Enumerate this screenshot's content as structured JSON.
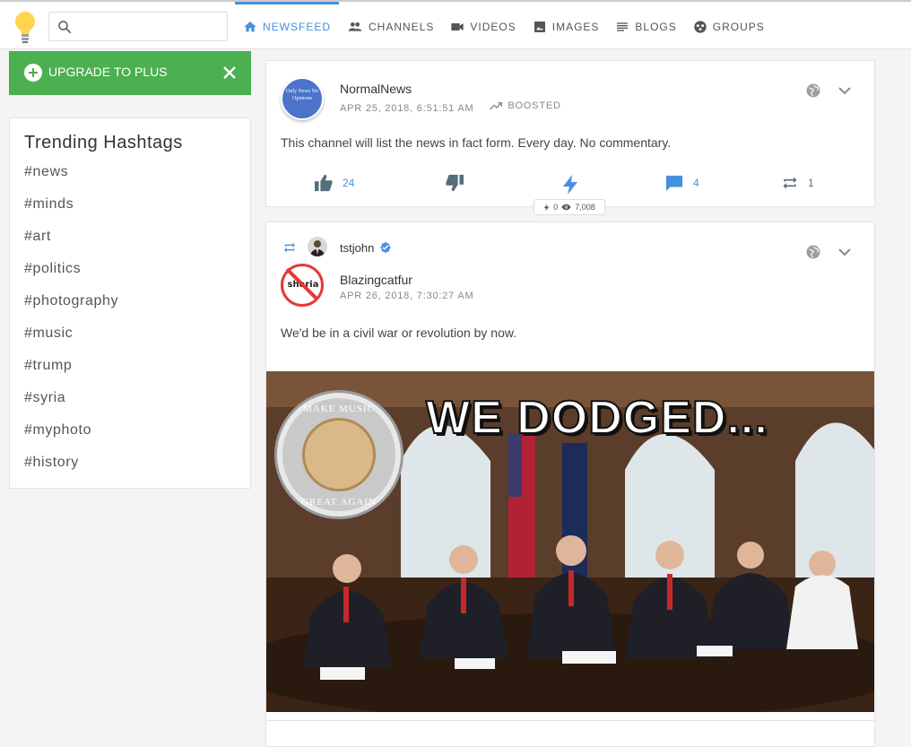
{
  "search": {
    "placeholder": ""
  },
  "nav": [
    {
      "label": "NEWSFEED",
      "icon": "home-icon",
      "active": true
    },
    {
      "label": "CHANNELS",
      "icon": "people-icon"
    },
    {
      "label": "VIDEOS",
      "icon": "video-icon"
    },
    {
      "label": "IMAGES",
      "icon": "image-icon"
    },
    {
      "label": "BLOGS",
      "icon": "blogs-icon"
    },
    {
      "label": "GROUPS",
      "icon": "groups-icon"
    }
  ],
  "upgrade": {
    "label": "UPGRADE TO PLUS"
  },
  "trending": {
    "title": "Trending Hashtags",
    "tags": [
      "#news",
      "#minds",
      "#art",
      "#politics",
      "#photography",
      "#music",
      "#trump",
      "#syria",
      "#myphoto",
      "#history"
    ]
  },
  "post1": {
    "avatar_text": "Only News No Opinions",
    "author": "NormalNews",
    "timestamp": "APR 25, 2018, 6:51:51 AM",
    "boosted": "BOOSTED",
    "text": "This channel will list the news in fact form. Every day. No commentary.",
    "likes": "24",
    "comments": "4",
    "reminds": "1",
    "wire_count": "0",
    "views": "7,008"
  },
  "post2": {
    "reminder": "tstjohn",
    "author": "Blazingcatfur",
    "avatar_text": "sharia",
    "timestamp": "APR 26, 2018, 7:30:27 AM",
    "text": "We'd be in a civil war or revolution by now.",
    "meme_caption": "WE DODGED...",
    "seal_top": "MAKE MUSIC",
    "seal_bottom": "GREAT AGAIN"
  },
  "colors": {
    "accent": "#4690df",
    "upgrade": "#4caf50",
    "ban": "#e53935"
  }
}
